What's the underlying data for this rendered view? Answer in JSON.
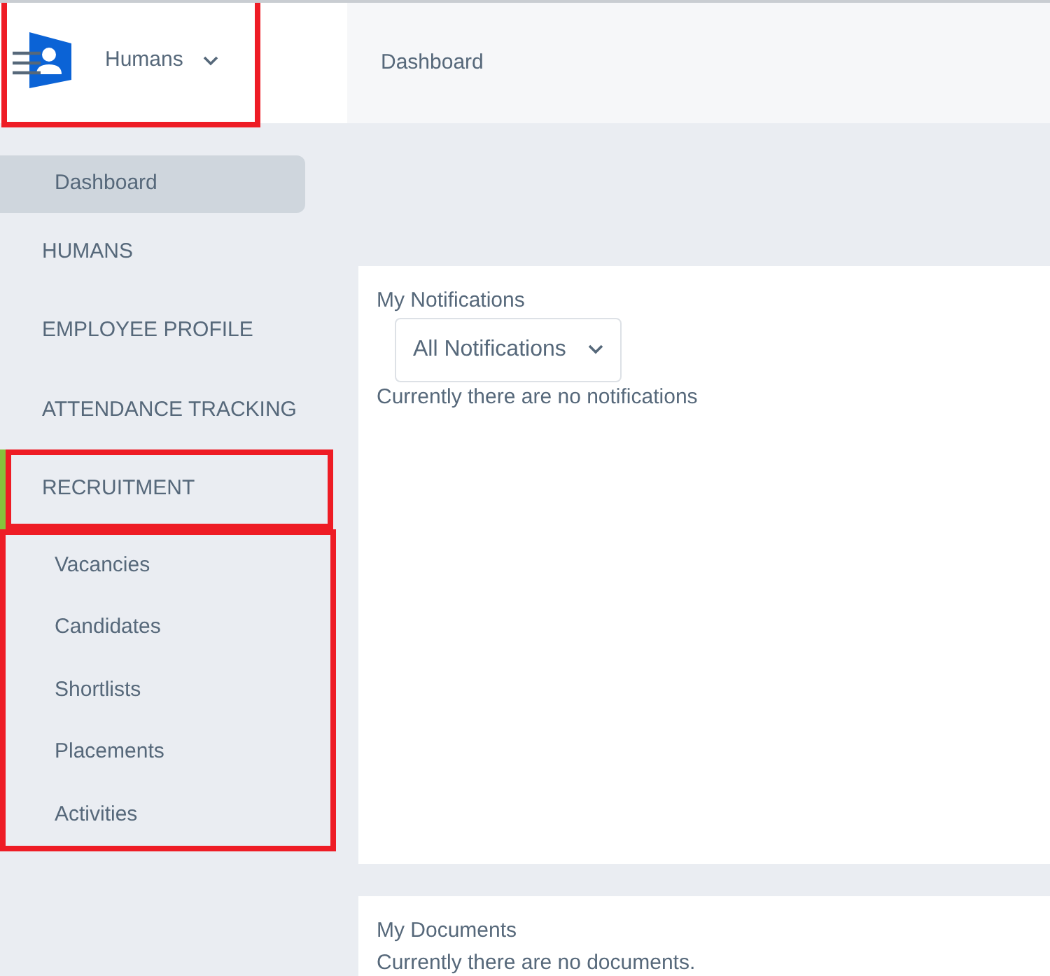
{
  "header": {
    "app_name": "Humans",
    "highlighted": true,
    "page_title": "Dashboard"
  },
  "sidebar": {
    "items": [
      {
        "kind": "link",
        "label": "Dashboard",
        "selected": true
      },
      {
        "kind": "section",
        "label": "HUMANS",
        "expanded": false,
        "highlighted": false
      },
      {
        "kind": "section",
        "label": "EMPLOYEE PROFILE",
        "expanded": false,
        "highlighted": false
      },
      {
        "kind": "section",
        "label": "ATTENDANCE TRACKING",
        "expanded": false,
        "highlighted": false
      },
      {
        "kind": "section",
        "label": "RECRUITMENT",
        "expanded": true,
        "highlighted": true,
        "children_highlighted": true,
        "children": [
          {
            "label": "Vacancies",
            "selected": false
          },
          {
            "label": "Candidates",
            "selected": false
          },
          {
            "label": "Shortlists",
            "selected": false
          },
          {
            "label": "Placements",
            "selected": false
          },
          {
            "label": "Activities",
            "selected": false
          }
        ]
      }
    ]
  },
  "panels": [
    {
      "title": "My Notifications",
      "filter": "All Notifications",
      "message": "Currently there are no notifications"
    },
    {
      "title": "My Documents",
      "message": "Currently there are no documents."
    }
  ]
}
